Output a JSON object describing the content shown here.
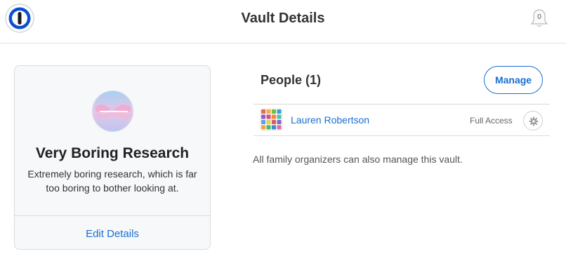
{
  "header": {
    "title": "Vault Details",
    "logo_icon": "1password-logo-icon",
    "notifications": {
      "icon": "bell-icon",
      "count": "0"
    }
  },
  "vault": {
    "name": "Very Boring Research",
    "description": "Extremely boring research, which is far too boring to bother looking at.",
    "edit_label": "Edit Details",
    "avatar": "vault-avatar-image"
  },
  "people": {
    "title": "People (1)",
    "manage_label": "Manage",
    "members": [
      {
        "name": "Lauren Robertson",
        "access": "Full Access",
        "settings_icon": "gear-icon"
      }
    ],
    "note": "All family organizers can also manage this vault."
  },
  "colors": {
    "link": "#1a6fd0",
    "logo": "#0a4fd0",
    "card_background": "#f7f8fa"
  }
}
